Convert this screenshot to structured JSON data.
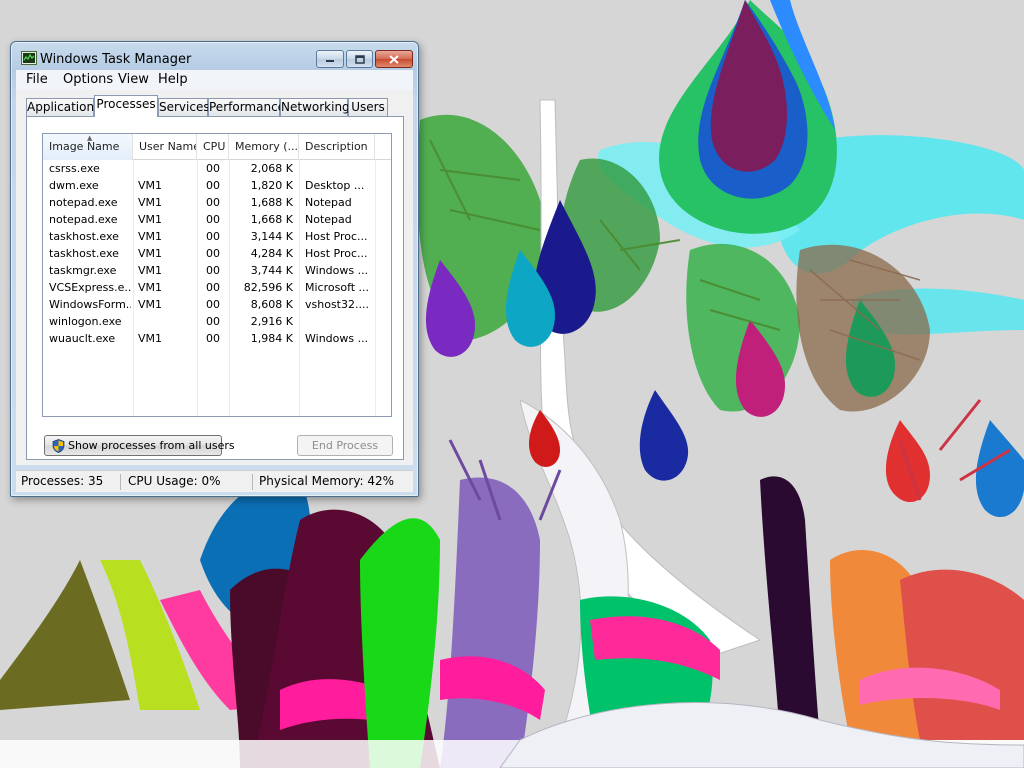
{
  "window": {
    "title": "Windows Task Manager"
  },
  "menu": [
    "File",
    "Options",
    "View",
    "Help"
  ],
  "tabs": [
    {
      "label": "Applications",
      "active": false
    },
    {
      "label": "Processes",
      "active": true
    },
    {
      "label": "Services",
      "active": false
    },
    {
      "label": "Performance",
      "active": false
    },
    {
      "label": "Networking",
      "active": false
    },
    {
      "label": "Users",
      "active": false
    }
  ],
  "table": {
    "columns": [
      "Image Name",
      "User Name",
      "CPU",
      "Memory (...",
      "Description"
    ],
    "sorted_column": "Image Name",
    "rows": [
      {
        "image": "csrss.exe",
        "user": "",
        "cpu": "00",
        "memory": "2,068 K",
        "description": ""
      },
      {
        "image": "dwm.exe",
        "user": "VM1",
        "cpu": "00",
        "memory": "1,820 K",
        "description": "Desktop ..."
      },
      {
        "image": "notepad.exe",
        "user": "VM1",
        "cpu": "00",
        "memory": "1,688 K",
        "description": "Notepad"
      },
      {
        "image": "notepad.exe",
        "user": "VM1",
        "cpu": "00",
        "memory": "1,668 K",
        "description": "Notepad"
      },
      {
        "image": "taskhost.exe",
        "user": "VM1",
        "cpu": "00",
        "memory": "3,144 K",
        "description": "Host Proc..."
      },
      {
        "image": "taskhost.exe",
        "user": "VM1",
        "cpu": "00",
        "memory": "4,284 K",
        "description": "Host Proc..."
      },
      {
        "image": "taskmgr.exe",
        "user": "VM1",
        "cpu": "00",
        "memory": "3,744 K",
        "description": "Windows ..."
      },
      {
        "image": "VCSExpress.e...",
        "user": "VM1",
        "cpu": "00",
        "memory": "82,596 K",
        "description": "Microsoft ..."
      },
      {
        "image": "WindowsForm...",
        "user": "VM1",
        "cpu": "00",
        "memory": "8,608 K",
        "description": "vshost32...."
      },
      {
        "image": "winlogon.exe",
        "user": "",
        "cpu": "00",
        "memory": "2,916 K",
        "description": ""
      },
      {
        "image": "wuauclt.exe",
        "user": "VM1",
        "cpu": "00",
        "memory": "1,984 K",
        "description": "Windows ..."
      }
    ]
  },
  "buttons": {
    "show_all": "Show processes from all users",
    "end_process": "End Process"
  },
  "status": {
    "processes": "Processes: 35",
    "cpu": "CPU Usage: 0%",
    "memory": "Physical Memory: 42%"
  },
  "icons": {
    "app": "task-manager-icon",
    "shield": "uac-shield-icon",
    "minimize": "minimize-icon",
    "maximize": "maximize-icon",
    "close": "close-icon"
  },
  "colors": {
    "title_bar": "#b9cfe6",
    "close_button": "#c7502f",
    "shield_blue": "#2e63b8",
    "shield_yellow": "#f2c200"
  }
}
